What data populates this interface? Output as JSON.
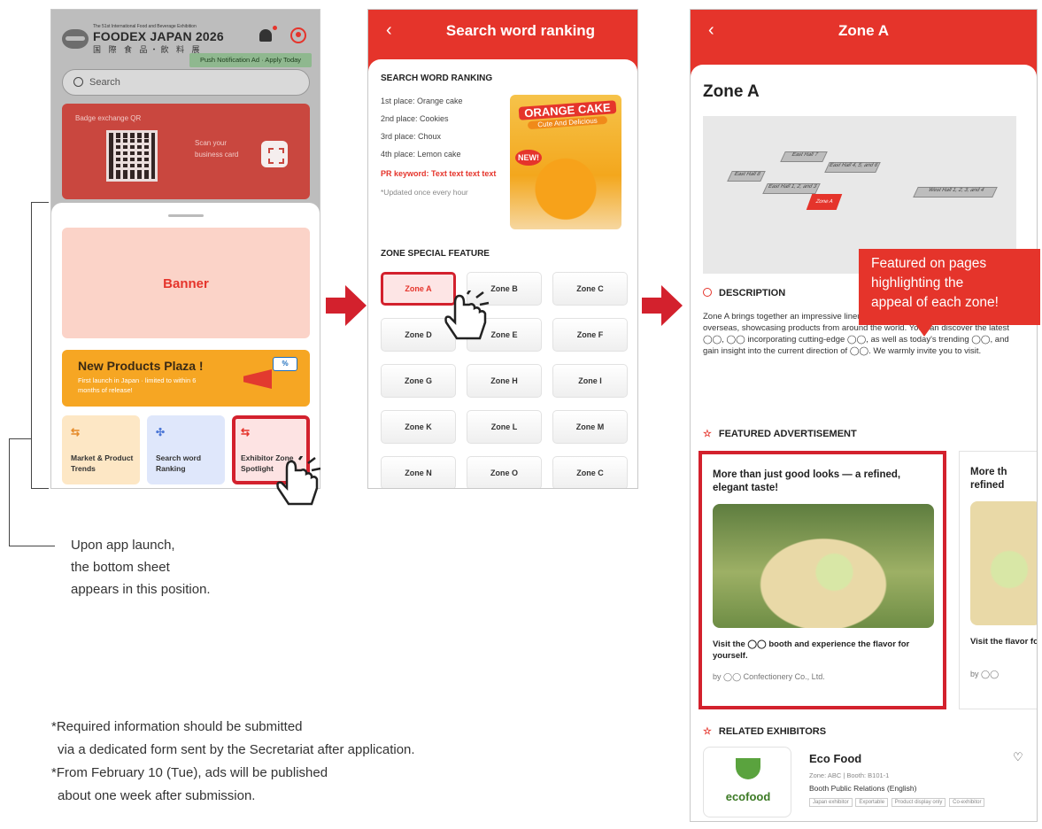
{
  "colors": {
    "accent": "#e5342b",
    "highlight": "#d3212d",
    "plaza": "#f6a623"
  },
  "screen1": {
    "logo_small": "The 51st International Food and Beverage Exhibition",
    "logo_main": "FOODEX JAPAN 2026",
    "logo_sub": "国 際 食 品・飲 料 展",
    "push_ad": "Push Notification Ad · Apply Today",
    "search_placeholder": "Search",
    "qr_title": "Badge exchange QR",
    "scan_text": "Scan your business card",
    "banner": "Banner",
    "plaza_title": "New Products Plaza !",
    "plaza_sub": "First launch in Japan · limited to within 6 months of release!",
    "tiles": [
      "Market & Product Trends",
      "Search word Ranking",
      "Exhibitor Zone Spotlight"
    ]
  },
  "screen2": {
    "title": "Search word ranking",
    "ranking_title": "SEARCH WORD RANKING",
    "ranks": [
      "1st place: Orange cake",
      "2nd place: Cookies",
      "3rd place: Choux",
      "4th place: Lemon cake"
    ],
    "pr_keyword": "PR keyword: Text text text text",
    "updated": "*Updated once every hour",
    "orange_title": "ORANGE CAKE",
    "orange_sub": "Cute And Delicious",
    "new_tag": "NEW!",
    "zone_title": "ZONE SPECIAL FEATURE",
    "zones": [
      "Zone A",
      "Zone B",
      "Zone C",
      "Zone D",
      "Zone E",
      "Zone F",
      "Zone G",
      "Zone H",
      "Zone I",
      "Zone K",
      "Zone L",
      "Zone M",
      "Zone N",
      "Zone O",
      "Zone C"
    ]
  },
  "screen3": {
    "header": "Zone A",
    "title": "Zone A",
    "map_labels": [
      "East Hall 7",
      "East Hall 4, 5, and 6",
      "East Hall 1, 2, and 3",
      "East Hall 8",
      "West Hall 1, 2, 3, and 4",
      "Zone A"
    ],
    "desc_head": "DESCRIPTION",
    "desc_text": "Zone A brings together an impressive lineup of exhibitors from across Japan and overseas, showcasing products from around the world. You can discover the latest ◯◯, ◯◯ incorporating cutting-edge ◯◯, as well as today's trending ◯◯, and gain insight into the current direction of ◯◯. We warmly invite you to visit.",
    "feat_head": "FEATURED ADVERTISEMENT",
    "ad_head": "More than just good looks — a refined, elegant taste!",
    "ad_foot": "Visit the ◯◯ booth and experience the flavor for yourself.",
    "ad_by": "by ◯◯ Confectionery Co., Ltd.",
    "ad2_head": "More th refined",
    "ad2_foot": "Visit the flavor fo",
    "ad2_by": "by ◯◯",
    "rel_head": "RELATED EXHIBITORS",
    "exh_name": "Eco Food",
    "exh_logo": "ecofood",
    "exh_zone": "Zone: ABC  |  Booth: B101-1",
    "exh_pr": "Booth Public Relations (English)",
    "exh_tags": [
      "Japan exhibitor",
      "Exportable",
      "Product display only",
      "Co-exhibitor"
    ]
  },
  "annotations": {
    "bottom_sheet_note": [
      "Upon app launch,",
      "the bottom sheet",
      "appears in this position."
    ],
    "callout": [
      "Featured on pages",
      "highlighting the",
      "appeal of each zone!"
    ],
    "footnotes": [
      "*Required information should be submitted",
      "via a dedicated form sent by the Secretariat after application.",
      "*From February 10 (Tue), ads will be published",
      "about one week after submission."
    ]
  }
}
